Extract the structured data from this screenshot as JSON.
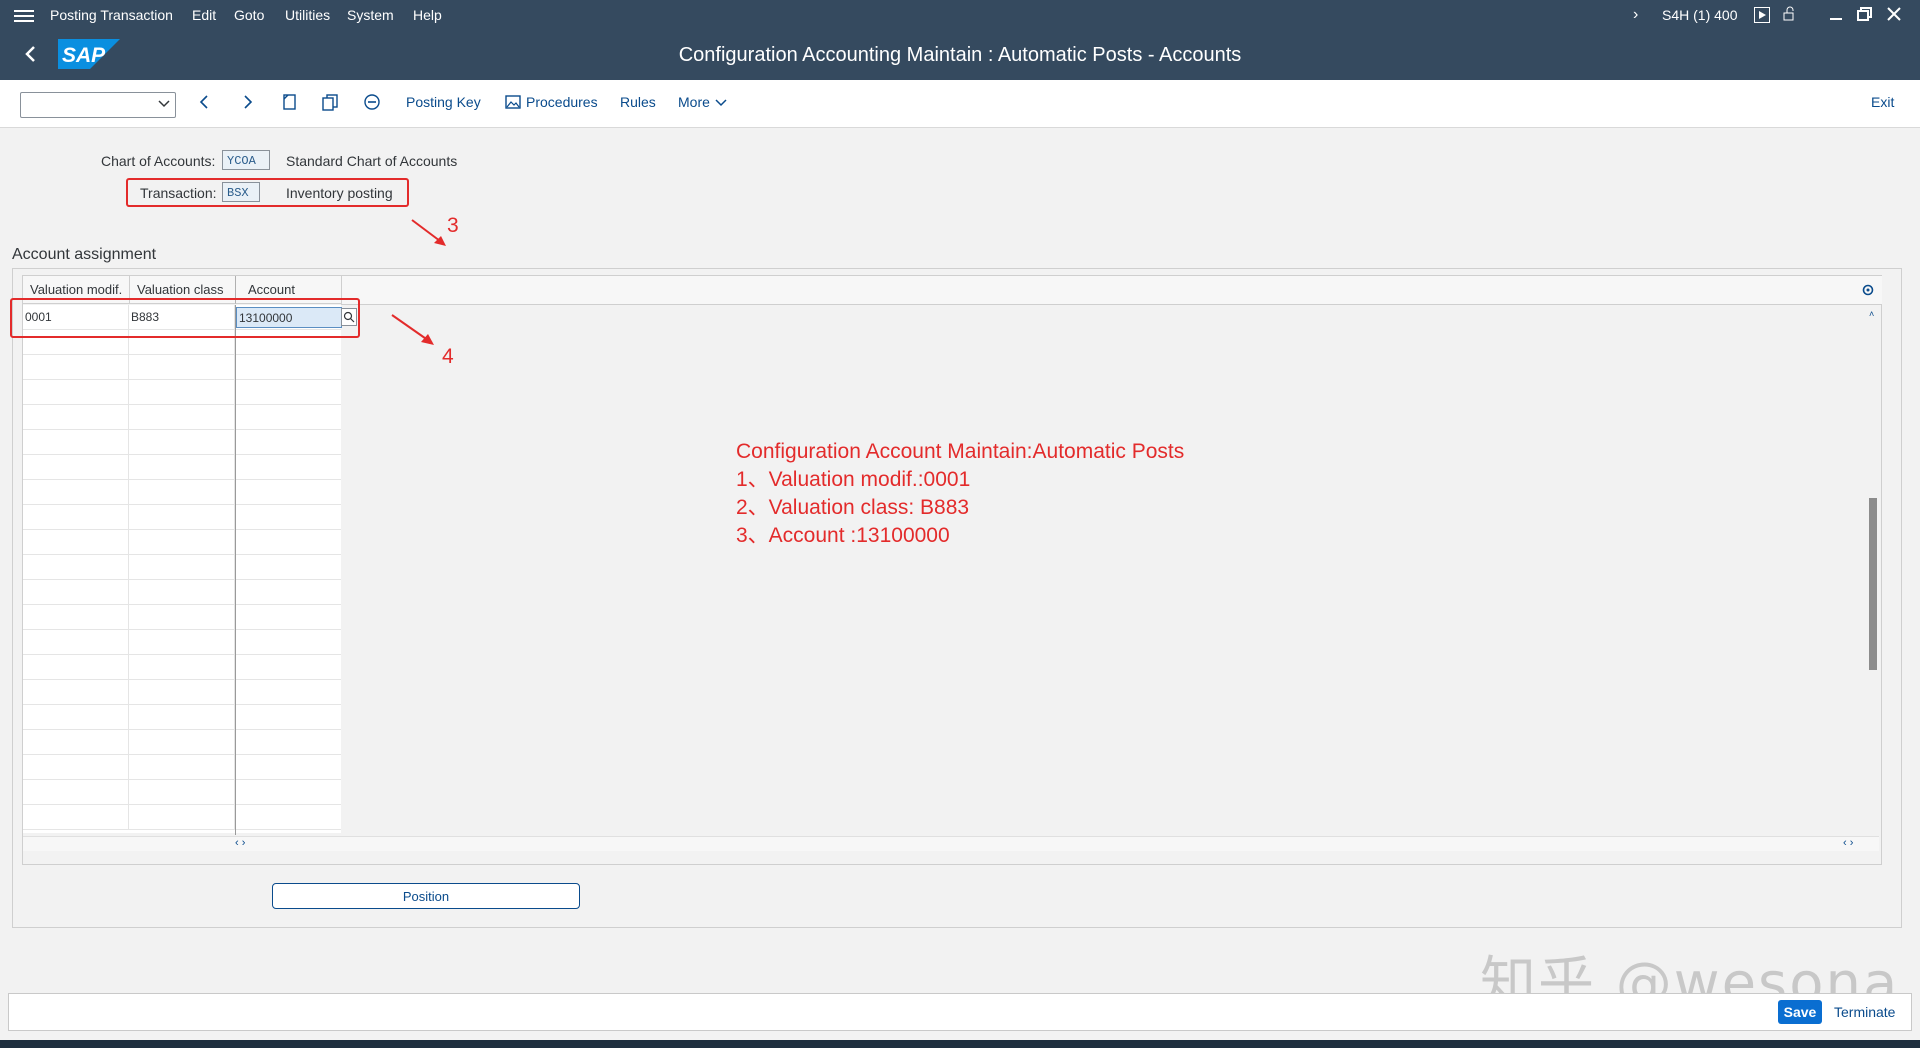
{
  "menu": {
    "items": [
      "Posting Transaction",
      "Edit",
      "Goto",
      "Utilities",
      "System",
      "Help"
    ],
    "system_info": "S4H (1) 400"
  },
  "title": "Configuration Accounting Maintain : Automatic Posts - Accounts",
  "logo_text": "SAP",
  "toolbar": {
    "posting_key": "Posting Key",
    "procedures": "Procedures",
    "rules": "Rules",
    "more": "More",
    "exit": "Exit"
  },
  "header_fields": {
    "chart_label": "Chart of Accounts:",
    "chart_value": "YCOA",
    "chart_desc": "Standard Chart of Accounts",
    "trans_label": "Transaction:",
    "trans_value": "BSX",
    "trans_desc": "Inventory posting"
  },
  "section_title": "Account assignment",
  "table": {
    "columns": [
      "Valuation modif.",
      "Valuation class",
      "Account"
    ],
    "rows": [
      [
        "0001",
        "B883",
        "13100000"
      ]
    ]
  },
  "annotations": {
    "step3": "3",
    "step4": "4",
    "lines": [
      "Configuration Account Maintain:Automatic Posts",
      "1、Valuation modif.:0001",
      "2、Valuation class: B883",
      "3、Account :13100000"
    ]
  },
  "position_button": "Position",
  "footer": {
    "save": "Save",
    "terminate": "Terminate"
  },
  "watermark": "知乎 @wesona",
  "colors": {
    "shell": "#354a5f",
    "accent": "#0a6ed1",
    "annotation_red": "#e32b2b"
  }
}
